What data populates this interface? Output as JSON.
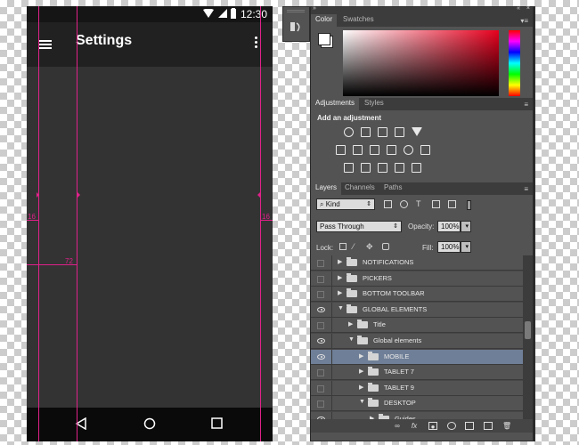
{
  "phone": {
    "status_time": "12:30",
    "app_title": "Settings",
    "guide_labels": {
      "left_margin": "16",
      "right_margin": "16",
      "keyline": "72"
    }
  },
  "panel": {
    "color_tabs": [
      "Color",
      "Swatches"
    ],
    "adjust_tabs": [
      "Adjustments",
      "Styles"
    ],
    "adjust_heading": "Add an adjustment",
    "layer_tabs": [
      "Layers",
      "Channels",
      "Paths"
    ],
    "filter_kind": "Kind",
    "blend_mode": "Pass Through",
    "opacity_label": "Opacity:",
    "opacity_value": "100%",
    "lock_label": "Lock:",
    "fill_label": "Fill:",
    "fill_value": "100%",
    "layers": [
      {
        "name": "NOTIFICATIONS",
        "visible": false,
        "expanded": false,
        "indent": 0,
        "selected": false
      },
      {
        "name": "PICKERS",
        "visible": false,
        "expanded": false,
        "indent": 0,
        "selected": false
      },
      {
        "name": "BOTTOM TOOLBAR",
        "visible": false,
        "expanded": false,
        "indent": 0,
        "selected": false
      },
      {
        "name": "GLOBAL ELEMENTS",
        "visible": true,
        "expanded": true,
        "indent": 0,
        "selected": false
      },
      {
        "name": "Title",
        "visible": false,
        "expanded": false,
        "indent": 1,
        "selected": false
      },
      {
        "name": "Global elements",
        "visible": true,
        "expanded": true,
        "indent": 1,
        "selected": false
      },
      {
        "name": "MOBILE",
        "visible": true,
        "expanded": false,
        "indent": 2,
        "selected": true
      },
      {
        "name": "TABLET 7",
        "visible": false,
        "expanded": false,
        "indent": 2,
        "selected": false
      },
      {
        "name": "TABLET 9",
        "visible": false,
        "expanded": false,
        "indent": 2,
        "selected": false
      },
      {
        "name": "DESKTOP",
        "visible": false,
        "expanded": true,
        "indent": 2,
        "selected": false
      },
      {
        "name": "Guides",
        "visible": true,
        "expanded": false,
        "indent": 3,
        "selected": false
      }
    ],
    "colors": {
      "accent_guide": "#e0218a",
      "selected_row": "#6f7f97",
      "panel_bg": "#535353"
    }
  }
}
